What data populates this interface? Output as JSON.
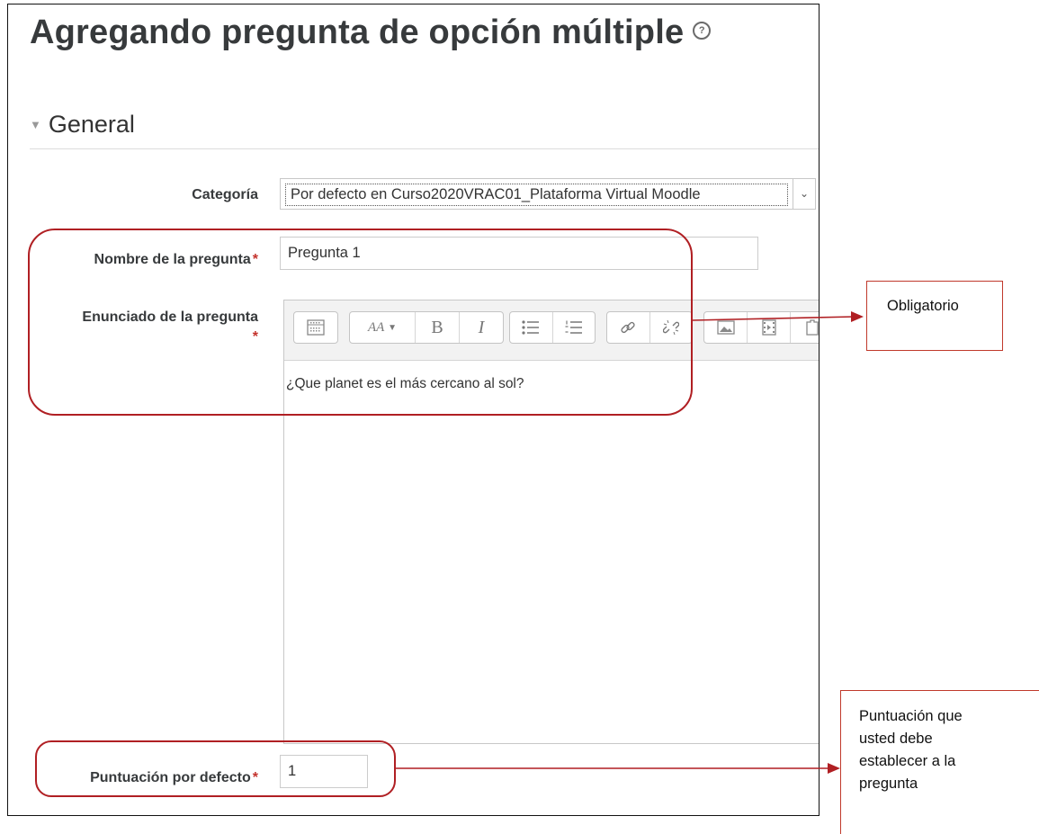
{
  "header": {
    "title": "Agregando pregunta de opción múltiple",
    "help_glyph": "?"
  },
  "section": {
    "title": "General",
    "caret": "▼"
  },
  "fields": {
    "category": {
      "label": "Categoría",
      "value": "Por defecto en Curso2020VRAC01_Plataforma Virtual Moodle",
      "arrow": "⌄"
    },
    "question_name": {
      "label": "Nombre de la pregunta",
      "value": "Pregunta 1",
      "required_mark": "*"
    },
    "question_text": {
      "label": "Enunciado de la pregunta",
      "required_mark": "*",
      "value": "¿Que planet es el más cercano al sol?"
    },
    "default_mark": {
      "label": "Puntuación por defecto",
      "value": "1",
      "required_mark": "*"
    }
  },
  "toolbar": {
    "groups": [
      [
        "toolbar-toggle-icon"
      ],
      [
        "font-style-icon",
        "bold-icon",
        "italic-icon"
      ],
      [
        "unordered-list-icon",
        "ordered-list-icon"
      ],
      [
        "link-icon",
        "unlink-icon"
      ],
      [
        "image-icon",
        "media-icon",
        "file-icon"
      ]
    ],
    "bold_glyph": "B",
    "italic_glyph": "I",
    "font_glyph": "AA"
  },
  "annotations": {
    "required_note": "Obligatorio",
    "mark_note": "Puntuación que usted debe establecer a la pregunta"
  },
  "colors": {
    "annotation_red": "#b01f23",
    "required_red": "#c4332d",
    "title": "#373a3c"
  }
}
